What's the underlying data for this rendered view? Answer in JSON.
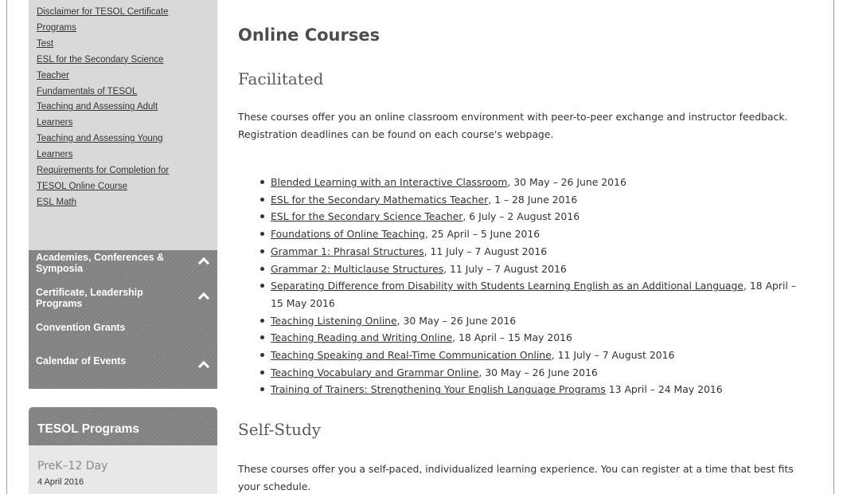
{
  "sidebar": {
    "sub_links": [
      "Disclaimer for TESOL Certificate",
      "Programs",
      "Test",
      "ESL for the Secondary Science",
      "Teacher",
      "Fundamentals of TESOL",
      "Teaching and Assessing Adult",
      "Learners",
      "Teaching and Assessing Young",
      "Learners",
      "Requirements for Completion for",
      "TESOL Online Course",
      "ESL Math"
    ],
    "sections": [
      {
        "label": "Academies, Conferences & Symposia",
        "expanded_icon": "chevron-up-icon"
      },
      {
        "label": "Certificate, Leadership Programs",
        "expanded_icon": "chevron-up-icon"
      },
      {
        "label": "Convention Grants"
      },
      {
        "label": "Calendar of Events",
        "expanded_icon": "chevron-up-icon"
      }
    ],
    "programs": {
      "heading": "TESOL Programs",
      "event_title": "PreK–12 Day",
      "event_date": "4 April 2016"
    }
  },
  "main": {
    "title": "Online Courses",
    "facilitated": {
      "heading": "Facilitated",
      "description": "These courses offer you an online classroom environment with peer-to-peer exchange and instructor feedback. Registration deadlines can be found on each course's webpage.",
      "courses": [
        {
          "link": "Blended Learning with an Interactive Classroom",
          "dates": ", 30 May – 26 June 2016"
        },
        {
          "link": "ESL for the Secondary Mathematics Teacher",
          "dates": ", 1 – 28 June 2016"
        },
        {
          "link": "ESL for the Secondary Science Teacher",
          "dates": ", 6 July – 2 August 2016"
        },
        {
          "link": "Foundations of Online Teaching",
          "dates": ", 25 April – 5 June 2016"
        },
        {
          "link": "Grammar 1: Phrasal Structures",
          "dates": ", 11 July – 7 August 2016"
        },
        {
          "link": "Grammar 2: Multiclause Structures",
          "dates": ", 11 July – 7 August 2016"
        },
        {
          "link": "Separating Difference from Disability with Students Learning English as an Additional Language",
          "dates": ", 18 April – 15 May 2016"
        },
        {
          "link": "Teaching Listening Online",
          "dates": ", 30 May – 26 June 2016"
        },
        {
          "link": "Teaching Reading and Writing Online",
          "dates": ", 18 April – 15 May 2016"
        },
        {
          "link": "Teaching Speaking and Real-Time Communication Online",
          "dates": ", 11 July – 7 August 2016"
        },
        {
          "link": "Teaching Vocabulary and Grammar Online",
          "dates": ", 30 May – 26 June 2016"
        },
        {
          "link": "Training of Trainers: Strengthening Your English Language Programs",
          "dates": " 13 April – 24 May 2016"
        }
      ]
    },
    "self_study": {
      "heading": "Self-Study",
      "description": "These courses offer you a self-paced, individualized learning experience. You can register at a time that best fits your schedule."
    }
  },
  "colors": {
    "sidebar_bg": "#d9d9d9",
    "section_bg": "#828282",
    "text": "#333333"
  }
}
